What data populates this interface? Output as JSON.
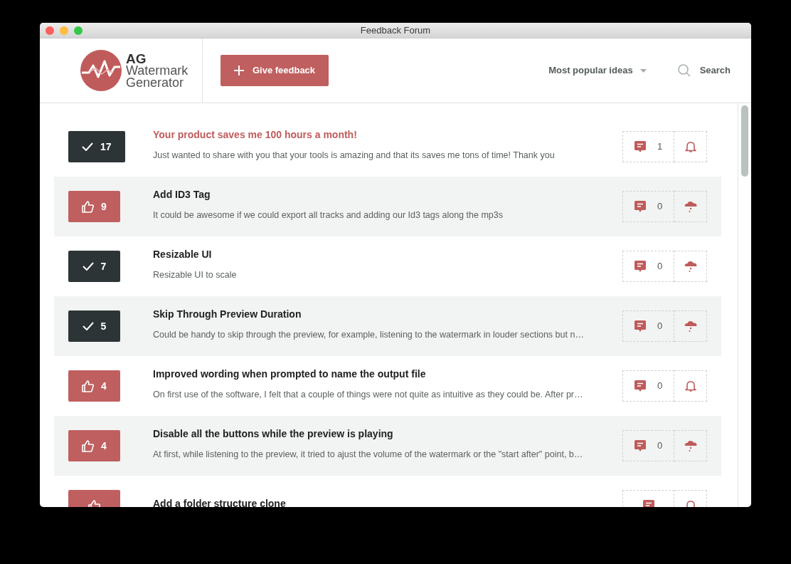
{
  "window": {
    "title": "Feedback Forum"
  },
  "header": {
    "logo": {
      "line_1": "AG",
      "line_2": "Watermark",
      "line_3": "Generator"
    },
    "give_feedback": "Give feedback",
    "sort": "Most popular ideas",
    "search": "Search"
  },
  "ideas": [
    {
      "completed": true,
      "votes": "17",
      "title": "Your product saves me 100 hours a month!",
      "highlighted": true,
      "description": "Just wanted to share with you that your tools is amazing and that its saves me tons of time! Thank you",
      "comments": "1",
      "subscribed": true
    },
    {
      "completed": false,
      "votes": "9",
      "title": "Add ID3 Tag",
      "highlighted": false,
      "description": "It could be awesome if we could export all tracks and adding our Id3 tags along the mp3s",
      "comments": "0",
      "subscribed": false
    },
    {
      "completed": true,
      "votes": "7",
      "title": "Resizable UI",
      "highlighted": false,
      "description": "Resizable UI to scale",
      "comments": "0",
      "subscribed": false
    },
    {
      "completed": true,
      "votes": "5",
      "title": "Skip Through Preview Duration",
      "highlighted": false,
      "description": "Could be handy to skip through the preview, for example, listening to the watermark in louder sections but n…",
      "comments": "0",
      "subscribed": false
    },
    {
      "completed": false,
      "votes": "4",
      "title": "Improved wording when prompted to name the output file",
      "highlighted": false,
      "description": "On first use of the software, I felt that a couple of things were not quite as intuitive as they could be. After pr…",
      "comments": "0",
      "subscribed": true
    },
    {
      "completed": false,
      "votes": "4",
      "title": "Disable all the buttons while the preview is playing",
      "highlighted": false,
      "description": "At first, while listening to the preview, it tried to ajust the volume of the watermark or the \"start after\" point, b…",
      "comments": "0",
      "subscribed": false
    },
    {
      "completed": false,
      "title": "Add a folder structure clone",
      "highlighted": false,
      "subscribed": true
    }
  ]
}
